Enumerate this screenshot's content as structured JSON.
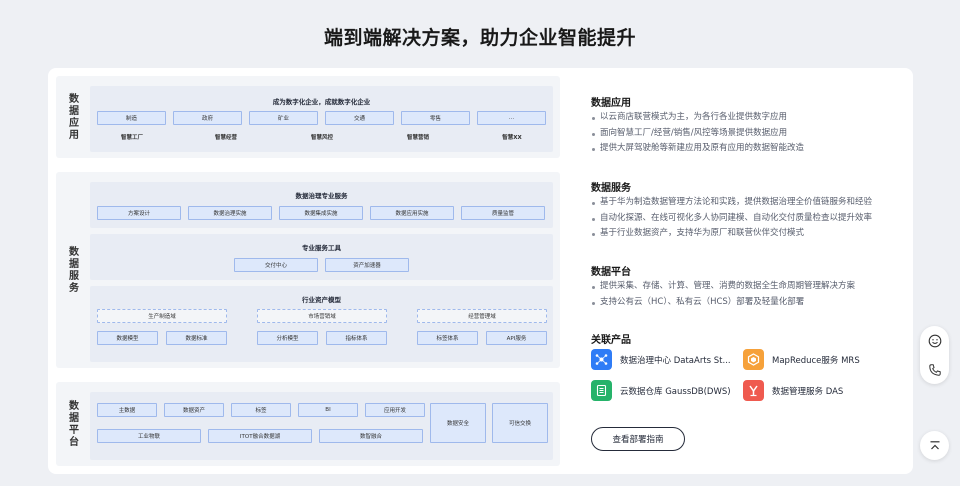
{
  "title": "端到端解决方案，助力企业智能提升",
  "arch": {
    "app": {
      "label": "数据应用",
      "heading": "成为数字化企业，成就数字化企业",
      "industries": [
        "制造",
        "政府",
        "矿业",
        "交通",
        "零售",
        "..."
      ],
      "solutions": [
        "智慧工厂",
        "智慧经营",
        "智慧风控",
        "智慧营销",
        "智慧XX"
      ]
    },
    "services": {
      "label": "数据服务",
      "pro": {
        "title": "数据治理专业服务",
        "items": [
          "方案设计",
          "数据治理实施",
          "数据集成实施",
          "数据应用实施",
          "质量监管"
        ]
      },
      "tools": {
        "title": "专业服务工具",
        "items": [
          "交付中心",
          "资产加速器"
        ]
      },
      "models": {
        "title": "行业资产模型",
        "domains": [
          "生产制造域",
          "市场营销域",
          "经营管理域"
        ],
        "items": [
          "数据模型",
          "数据标准",
          "分析模型",
          "指标体系",
          "标签体系",
          "API服务"
        ]
      }
    },
    "platform": {
      "label": "数据平台",
      "row1": [
        "主数据",
        "数据资产",
        "标签",
        "BI",
        "应用开发"
      ],
      "row2": [
        "工业物联",
        "ITOT融合数据湖",
        "数智融合"
      ],
      "side": [
        "数据安全",
        "可信交换"
      ]
    }
  },
  "info": {
    "sections": [
      {
        "title": "数据应用",
        "bullets": [
          "以云商店联营模式为主，为各行各业提供数字应用",
          "面向智慧工厂/经营/销售/风控等场景提供数据应用",
          "提供大屏驾驶舱等新建应用及原有应用的数据智能改造"
        ]
      },
      {
        "title": "数据服务",
        "bullets": [
          "基于华为制造数据管理方法论和实践，提供数据治理全价值链服务和经验",
          "自动化探源、在线可视化多人协同建模、自动化交付质量检查以提升效率",
          "基于行业数据资产，支持华为原厂和联营伙伴交付模式"
        ]
      },
      {
        "title": "数据平台",
        "bullets": [
          "提供采集、存储、计算、管理、消费的数据全生命周期管理解决方案",
          "支持公有云（HC）、私有云（HCS）部署及轻量化部署"
        ]
      }
    ],
    "products_title": "关联产品",
    "products": [
      {
        "name": "数据治理中心 DataArts St...",
        "icon": "dataarts-icon",
        "color": "#2f7cf6"
      },
      {
        "name": "MapReduce服务 MRS",
        "icon": "mrs-icon",
        "color": "#f6a13a"
      },
      {
        "name": "云数据仓库 GaussDB(DWS)",
        "icon": "dws-icon",
        "color": "#26b36a"
      },
      {
        "name": "数据管理服务 DAS",
        "icon": "das-icon",
        "color": "#ef5a4f"
      }
    ],
    "guide_button": "查看部署指南"
  },
  "float_icons": [
    "smile-icon",
    "phone-icon",
    "back-to-top-icon"
  ]
}
